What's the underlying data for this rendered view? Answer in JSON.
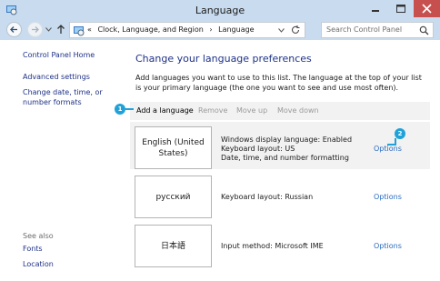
{
  "window": {
    "title": "Language"
  },
  "address_bar": {
    "crumbs": [
      "«",
      "Clock, Language, and Region",
      "›",
      "Language"
    ]
  },
  "search": {
    "placeholder": "Search Control Panel"
  },
  "sidebar": {
    "home": "Control Panel Home",
    "links": [
      "Advanced settings",
      "Change date, time, or number formats"
    ],
    "see_also_label": "See also",
    "see_also": [
      "Fonts",
      "Location"
    ]
  },
  "main": {
    "heading": "Change your language preferences",
    "description": "Add languages you want to use to this list. The language at the top of your list is your primary language (the one you want to see and use most often)."
  },
  "toolbar": {
    "add": "Add a language",
    "remove": "Remove",
    "move_up": "Move up",
    "move_down": "Move down"
  },
  "languages": [
    {
      "name": "English (United States)",
      "info": [
        "Windows display language: Enabled",
        "Keyboard layout: US",
        "Date, time, and number formatting"
      ],
      "options": "Options"
    },
    {
      "name": "русский",
      "info": [
        "Keyboard layout: Russian"
      ],
      "options": "Options"
    },
    {
      "name": "日本語",
      "info": [
        "Input method: Microsoft IME"
      ],
      "options": "Options"
    }
  ],
  "callouts": [
    "1",
    "2"
  ],
  "colors": {
    "titlebar": "#c9dcef",
    "close_button": "#c7504f",
    "link": "#1e3287",
    "options_link": "#2a6cc0",
    "callout": "#20a2d8"
  }
}
